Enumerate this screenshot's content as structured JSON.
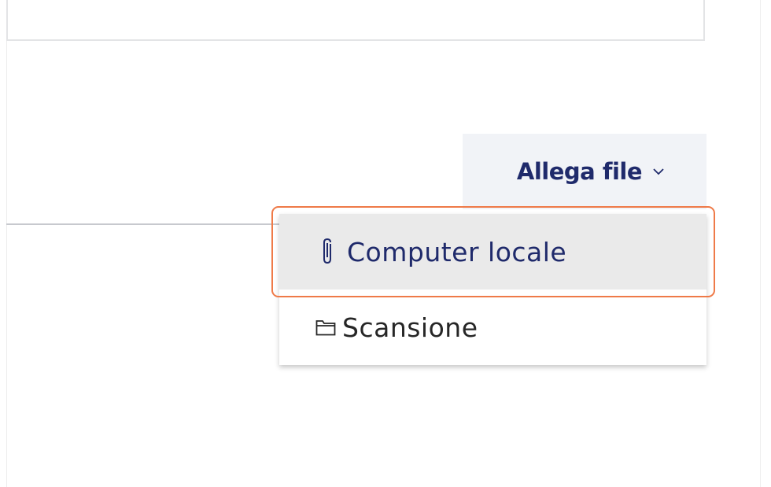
{
  "attach": {
    "label": "Allega file",
    "icon": "chevron-down-icon"
  },
  "menu": {
    "items": [
      {
        "label": "Computer locale",
        "icon": "paperclip-icon",
        "state": "hovered"
      },
      {
        "label": "Scansione",
        "icon": "folder-icon",
        "state": "normal"
      }
    ]
  },
  "colors": {
    "accent": "#1f2a6b",
    "button_bg": "#f1f3f7",
    "hover_bg": "#eaeaea",
    "highlight": "#ef7a48"
  }
}
